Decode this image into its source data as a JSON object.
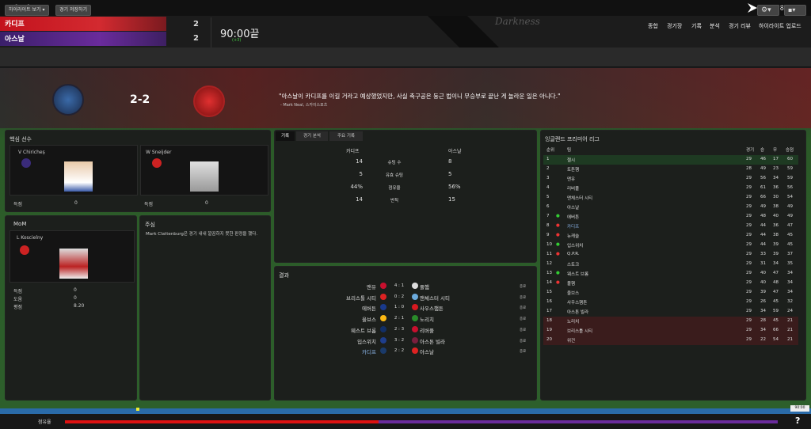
{
  "nav": {
    "back": "<",
    "forward": ">"
  },
  "header": {
    "home_team": "카디프",
    "away_team": "아스날",
    "home_score": "2",
    "away_score": "2",
    "clock": "90:00끝",
    "added_time": "(+3)",
    "watermark": "Darkness",
    "continue_label": "진행하기",
    "menu": [
      "종합",
      "경기장",
      "기록",
      "분석",
      "경기 리뷰",
      "하이라이트 업로드"
    ]
  },
  "toolbar": {
    "highlights_label": "하이라이트 보기",
    "save_label": "경기 저장하기"
  },
  "banner": {
    "score": "2-2",
    "quote": "\"아스날이 카디프를 이길 거라고 예상했었지만, 사실 축구공은 둥근 법이니 무승부로 끝난 게 놀라운 일은 아니다.\"",
    "quote_source": "- Mark Neal, 스카이스포츠"
  },
  "key_players": {
    "title": "핵심 선수",
    "players": [
      {
        "name": "V Chiricheș",
        "stat_label": "득점",
        "stat_value": "0"
      },
      {
        "name": "W Sneijder",
        "stat_label": "득점",
        "stat_value": "0"
      }
    ]
  },
  "mom": {
    "title": "MoM",
    "name": "L Koscielny",
    "stats": [
      {
        "label": "득점",
        "value": "0"
      },
      {
        "label": "도움",
        "value": "0"
      },
      {
        "label": "평점",
        "value": "8.20"
      }
    ]
  },
  "referee": {
    "title": "주심",
    "text": "Mark Clattenburg은 경기 내내 깔끔하지 못한 판정을 했다."
  },
  "stats": {
    "tabs": [
      "기록",
      "경기 분석",
      "주요 기록"
    ],
    "home": "카디프",
    "away": "아스날",
    "rows": [
      {
        "label": "슈팅 수",
        "home": "14",
        "away": "8"
      },
      {
        "label": "유효 슈팅",
        "home": "5",
        "away": "5"
      },
      {
        "label": "점유율",
        "home": "44%",
        "away": "56%"
      },
      {
        "label": "반칙",
        "home": "14",
        "away": "15"
      }
    ]
  },
  "results": {
    "title": "결과",
    "ft_label": "종료",
    "rows": [
      {
        "home": "맨유",
        "score": "4 : 1",
        "away": "풀햄",
        "hc": "#c8102e",
        "ac": "#ddd"
      },
      {
        "home": "브리스톨 시티",
        "score": "0 : 2",
        "away": "맨체스터 시티",
        "hc": "#d22",
        "ac": "#6cabdd"
      },
      {
        "home": "에버튼",
        "score": "1 : 0",
        "away": "사우스햄튼",
        "hc": "#1a3a8c",
        "ac": "#d71920"
      },
      {
        "home": "울브스",
        "score": "2 : 1",
        "away": "노리치",
        "hc": "#fdb913",
        "ac": "#2a8a2a"
      },
      {
        "home": "웨스트 브롬",
        "score": "2 : 3",
        "away": "리버풀",
        "hc": "#122f67",
        "ac": "#c8102e"
      },
      {
        "home": "입스위치",
        "score": "3 : 2",
        "away": "아스톤 빌라",
        "hc": "#1e3e8c",
        "ac": "#7a1f3d"
      },
      {
        "home": "카디프",
        "score": "2 : 2",
        "away": "아스날",
        "hc": "#1a3a6a",
        "ac": "#d22"
      }
    ]
  },
  "league": {
    "title": "잉글랜드 프리미어 리그",
    "headers": {
      "pos": "순위",
      "team": "팀",
      "played": "경기",
      "won": "승",
      "drawn": "무",
      "pts": "승점"
    },
    "rows": [
      {
        "pos": "1",
        "team": "첼시",
        "p": "29",
        "w": "46",
        "d": "17",
        "pts": "60",
        "mv": ""
      },
      {
        "pos": "2",
        "team": "토튼햄",
        "p": "28",
        "w": "49",
        "d": "23",
        "pts": "59",
        "mv": ""
      },
      {
        "pos": "3",
        "team": "맨유",
        "p": "29",
        "w": "56",
        "d": "34",
        "pts": "59",
        "mv": ""
      },
      {
        "pos": "4",
        "team": "리버풀",
        "p": "29",
        "w": "61",
        "d": "36",
        "pts": "56",
        "mv": ""
      },
      {
        "pos": "5",
        "team": "맨체스터 시티",
        "p": "29",
        "w": "66",
        "d": "30",
        "pts": "54",
        "mv": ""
      },
      {
        "pos": "6",
        "team": "아스날",
        "p": "29",
        "w": "49",
        "d": "38",
        "pts": "49",
        "mv": ""
      },
      {
        "pos": "7",
        "team": "에버튼",
        "p": "29",
        "w": "48",
        "d": "40",
        "pts": "49",
        "mv": "up"
      },
      {
        "pos": "8",
        "team": "카디프",
        "p": "29",
        "w": "44",
        "d": "36",
        "pts": "47",
        "mv": "down"
      },
      {
        "pos": "9",
        "team": "뉴캐슬",
        "p": "29",
        "w": "44",
        "d": "38",
        "pts": "45",
        "mv": "down"
      },
      {
        "pos": "10",
        "team": "입스위치",
        "p": "29",
        "w": "44",
        "d": "39",
        "pts": "45",
        "mv": "up"
      },
      {
        "pos": "11",
        "team": "Q.P.R.",
        "p": "29",
        "w": "33",
        "d": "39",
        "pts": "37",
        "mv": "down"
      },
      {
        "pos": "12",
        "team": "스토크",
        "p": "29",
        "w": "31",
        "d": "34",
        "pts": "35",
        "mv": ""
      },
      {
        "pos": "13",
        "team": "웨스트 브롬",
        "p": "29",
        "w": "40",
        "d": "47",
        "pts": "34",
        "mv": "up"
      },
      {
        "pos": "14",
        "team": "풀햄",
        "p": "29",
        "w": "40",
        "d": "48",
        "pts": "34",
        "mv": "down"
      },
      {
        "pos": "15",
        "team": "울브스",
        "p": "29",
        "w": "39",
        "d": "47",
        "pts": "34",
        "mv": ""
      },
      {
        "pos": "16",
        "team": "사우스햄튼",
        "p": "29",
        "w": "26",
        "d": "45",
        "pts": "32",
        "mv": ""
      },
      {
        "pos": "17",
        "team": "아스톤 빌라",
        "p": "29",
        "w": "34",
        "d": "59",
        "pts": "24",
        "mv": ""
      },
      {
        "pos": "18",
        "team": "노리치",
        "p": "29",
        "w": "28",
        "d": "45",
        "pts": "21",
        "mv": ""
      },
      {
        "pos": "19",
        "team": "브리스톨 시티",
        "p": "29",
        "w": "34",
        "d": "66",
        "pts": "21",
        "mv": ""
      },
      {
        "pos": "20",
        "team": "위건",
        "p": "29",
        "w": "22",
        "d": "54",
        "pts": "21",
        "mv": ""
      }
    ]
  },
  "footer": {
    "possession_label": "점유율",
    "home_possession": 44,
    "away_possession": 56,
    "timeline_time": "90:00",
    "help": "?"
  },
  "colors": {
    "home": "#c3121d",
    "away": "#6a2b9c",
    "up": "#3c3",
    "down": "#e33"
  }
}
